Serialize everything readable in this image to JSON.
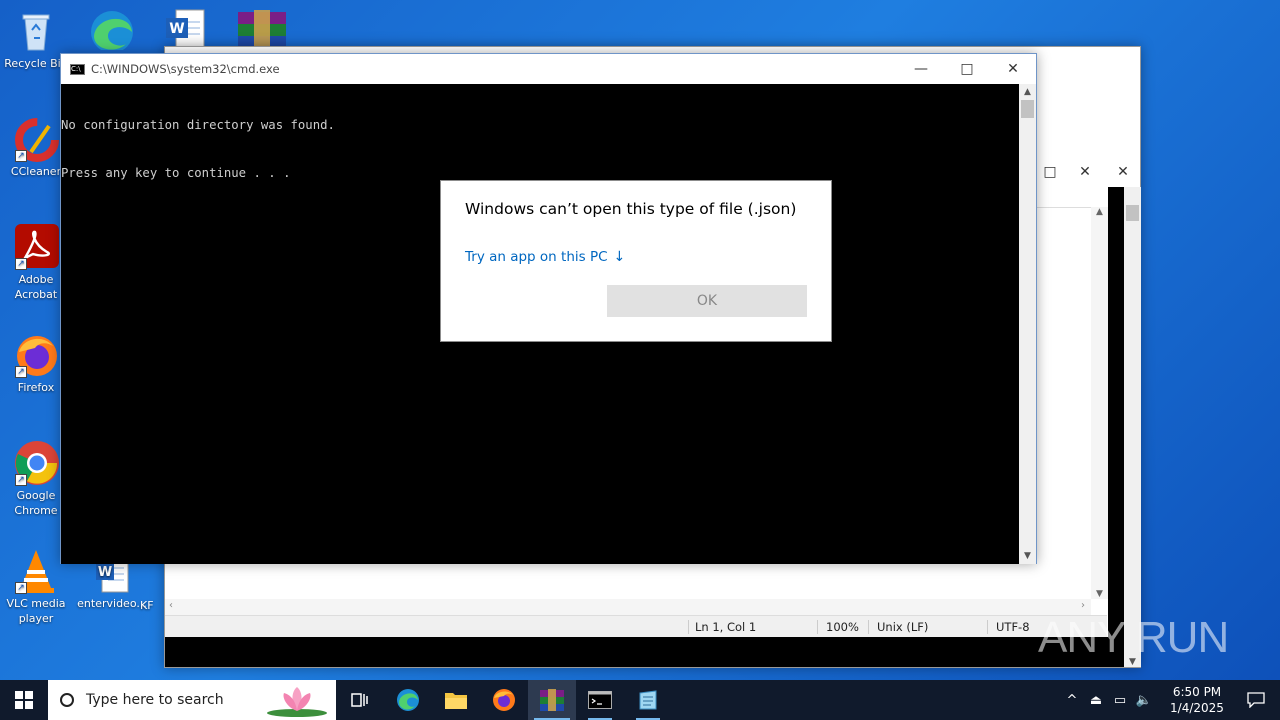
{
  "desktop": {
    "icons": [
      {
        "label": "Recycle Bin",
        "name": "recycle-bin"
      },
      {
        "label": "CCleaner",
        "name": "ccleaner"
      },
      {
        "label": "Adobe Acrobat",
        "name": "adobe-acrobat"
      },
      {
        "label": "Firefox",
        "name": "firefox"
      },
      {
        "label": "Google Chrome",
        "name": "google-chrome"
      },
      {
        "label": "VLC media player",
        "name": "vlc"
      },
      {
        "label": "entervideo...",
        "name": "word-doc"
      },
      {
        "label": "KF",
        "name": "kf"
      }
    ]
  },
  "cmd": {
    "title": "C:\\WINDOWS\\system32\\cmd.exe",
    "lines": [
      "No configuration directory was found.",
      "Press any key to continue . . ."
    ]
  },
  "notepad": {
    "status": {
      "position": "Ln 1, Col 1",
      "zoom": "100%",
      "line_ending": "Unix (LF)",
      "encoding": "UTF-8"
    }
  },
  "dialog": {
    "heading": "Windows can’t open this type of file (.json)",
    "link": "Try an app on this PC",
    "ok_label": "OK"
  },
  "taskbar": {
    "search_placeholder": "Type here to search",
    "time": "6:50 PM",
    "date": "1/4/2025"
  },
  "watermark": "ANY RUN"
}
